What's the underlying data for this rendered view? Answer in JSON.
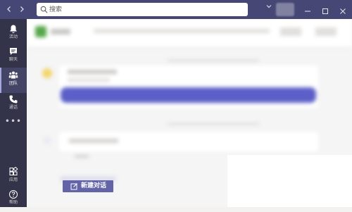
{
  "titlebar": {
    "back_icon": "chevron-left-icon",
    "forward_icon": "chevron-right-icon",
    "search": {
      "placeholder": "搜索",
      "icon": "search-icon"
    },
    "dropdown_icon": "chevron-down-icon",
    "window_controls": [
      "minimize-icon",
      "maximize-icon",
      "close-icon"
    ],
    "colors": {
      "background": "#464775"
    }
  },
  "sidebar": {
    "items": [
      {
        "label": "活动",
        "icon": "bell-icon"
      },
      {
        "label": "聊天",
        "icon": "chat-icon"
      },
      {
        "label": "团队",
        "icon": "teams-icon",
        "active": true
      },
      {
        "label": "通话",
        "icon": "phone-icon"
      }
    ],
    "more_label": "•••",
    "bottom_items": [
      {
        "label": "应用",
        "icon": "apps-icon"
      },
      {
        "label": "帮助",
        "icon": "help-icon"
      }
    ],
    "colors": {
      "background": "#33344a",
      "active": "#444566"
    }
  },
  "main": {
    "new_conversation_label": "新建对话",
    "new_conversation_icon": "compose-icon",
    "colors": {
      "accent": "#6264a7"
    }
  }
}
